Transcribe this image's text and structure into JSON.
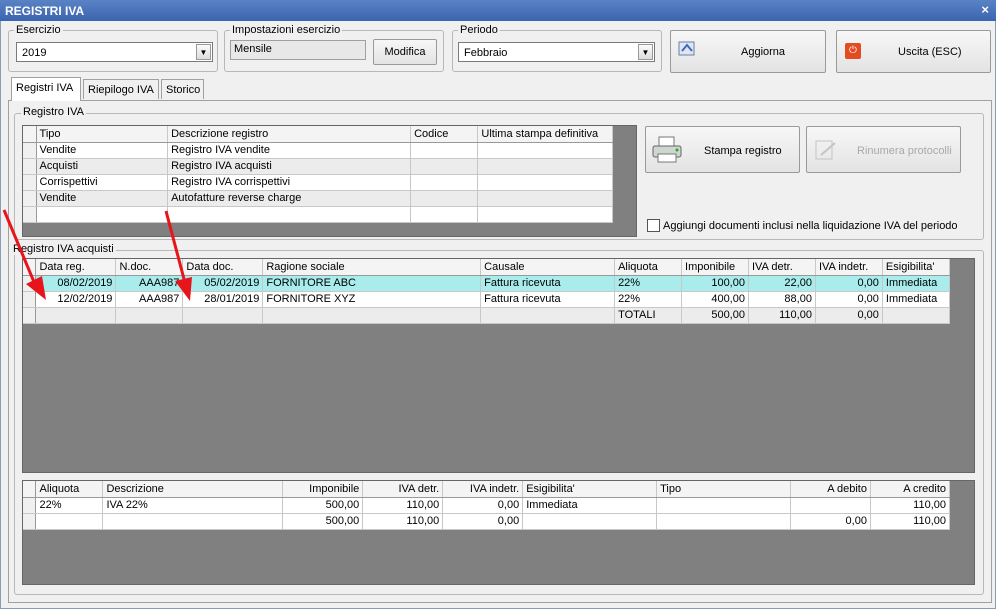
{
  "window": {
    "title": "REGISTRI IVA",
    "close": "×"
  },
  "esercizio": {
    "label": "Esercizio",
    "value": "2019"
  },
  "impostazioni": {
    "label": "Impostazioni esercizio",
    "value": "Mensile",
    "button": "Modifica"
  },
  "periodo": {
    "label": "Periodo",
    "value": "Febbraio"
  },
  "toolbar": {
    "aggiorna": "Aggiorna",
    "uscita": "Uscita (ESC)"
  },
  "tabs": [
    "Registri IVA",
    "Riepilogo IVA",
    "Storico"
  ],
  "registro_iva": {
    "label": "Registro IVA",
    "headers": [
      "Tipo",
      "Descrizione registro",
      "Codice",
      "Ultima stampa definitiva"
    ],
    "rows": [
      [
        "Vendite",
        "Registro IVA vendite",
        "",
        ""
      ],
      [
        "Acquisti",
        "Registro IVA acquisti",
        "",
        ""
      ],
      [
        "Corrispettivi",
        "Registro IVA corrispettivi",
        "",
        ""
      ],
      [
        "Vendite",
        "Autofatture reverse charge",
        "",
        ""
      ]
    ]
  },
  "stampa_registro": "Stampa registro",
  "rinumera_protocolli": "Rinumera protocolli",
  "aggiungi_documenti": "Aggiungi documenti inclusi nella liquidazione IVA del periodo",
  "registro_acquisti": {
    "label": "Registro IVA acquisti",
    "headers": [
      "Data reg.",
      "N.doc.",
      "Data doc.",
      "Ragione sociale",
      "Causale",
      "Aliquota",
      "Imponibile",
      "IVA detr.",
      "IVA indetr.",
      "Esigibilita'"
    ],
    "rows": [
      [
        "08/02/2019",
        "AAA987",
        "05/02/2019",
        "FORNITORE ABC",
        "Fattura ricevuta",
        "22%",
        "100,00",
        "22,00",
        "0,00",
        "Immediata"
      ],
      [
        "12/02/2019",
        "AAA987",
        "28/01/2019",
        "FORNITORE XYZ",
        "Fattura ricevuta",
        "22%",
        "400,00",
        "88,00",
        "0,00",
        "Immediata"
      ],
      [
        "",
        "",
        "",
        "",
        "",
        "TOTALI",
        "500,00",
        "110,00",
        "0,00",
        ""
      ]
    ]
  },
  "riepilogo": {
    "headers": [
      "Aliquota",
      "Descrizione",
      "Imponibile",
      "IVA detr.",
      "IVA indetr.",
      "Esigibilita'",
      "Tipo",
      "A debito",
      "A credito"
    ],
    "rows": [
      [
        "22%",
        "IVA 22%",
        "500,00",
        "110,00",
        "0,00",
        "Immediata",
        "",
        "",
        "110,00"
      ],
      [
        "",
        "",
        "500,00",
        "110,00",
        "0,00",
        "",
        "",
        "0,00",
        "110,00"
      ]
    ]
  },
  "colors": {
    "titlebar": "#3a64ae",
    "highlight_row": "#a9ecec",
    "grid_bg": "#808080",
    "arrow": "#e8141c"
  }
}
